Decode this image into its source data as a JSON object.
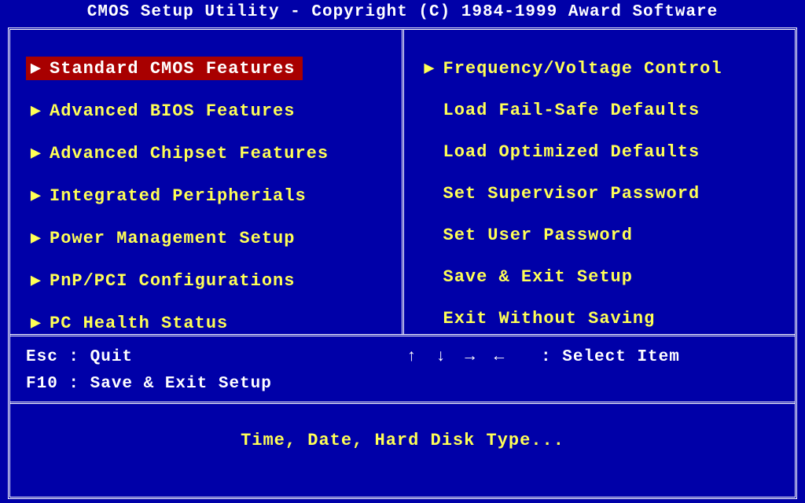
{
  "title": "CMOS Setup Utility - Copyright (C) 1984-1999 Award Software",
  "left_menu": [
    {
      "label": "Standard CMOS Features",
      "arrow": true,
      "selected": true
    },
    {
      "label": "Advanced BIOS Features",
      "arrow": true,
      "selected": false
    },
    {
      "label": "Advanced Chipset Features",
      "arrow": true,
      "selected": false
    },
    {
      "label": "Integrated Peripherials",
      "arrow": true,
      "selected": false
    },
    {
      "label": "Power Management Setup",
      "arrow": true,
      "selected": false
    },
    {
      "label": "PnP/PCI Configurations",
      "arrow": true,
      "selected": false
    },
    {
      "label": "PC Health Status",
      "arrow": true,
      "selected": false
    }
  ],
  "right_menu": [
    {
      "label": "Frequency/Voltage Control",
      "arrow": true,
      "selected": false
    },
    {
      "label": "Load Fail-Safe Defaults",
      "arrow": false,
      "selected": false
    },
    {
      "label": "Load Optimized Defaults",
      "arrow": false,
      "selected": false
    },
    {
      "label": "Set Supervisor Password",
      "arrow": false,
      "selected": false
    },
    {
      "label": "Set User Password",
      "arrow": false,
      "selected": false
    },
    {
      "label": "Save & Exit Setup",
      "arrow": false,
      "selected": false
    },
    {
      "label": "Exit Without Saving",
      "arrow": false,
      "selected": false
    }
  ],
  "help": {
    "esc": "Esc : Quit",
    "f10": "F10 : Save & Exit Setup",
    "arrows": "↑ ↓ → ←",
    "select": ": Select Item"
  },
  "description": "Time, Date, Hard Disk Type..."
}
